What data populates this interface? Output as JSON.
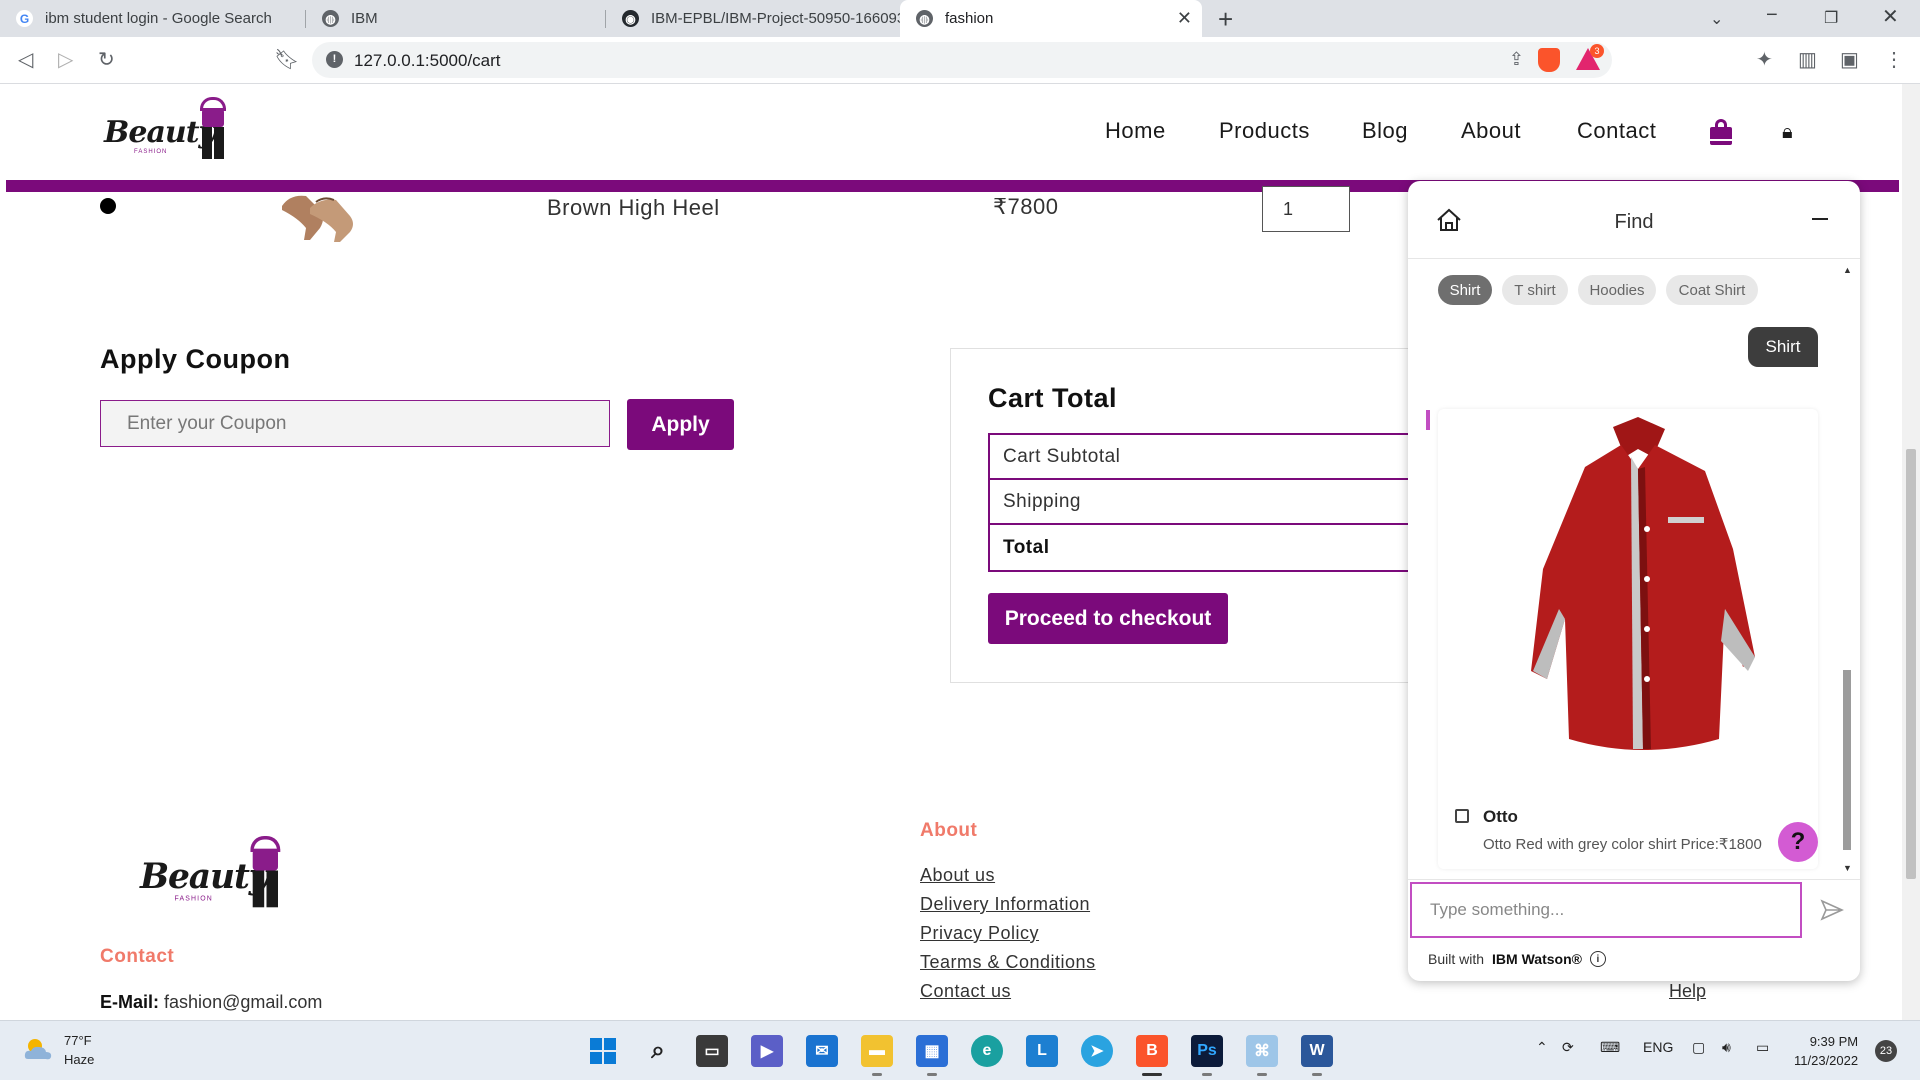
{
  "browser": {
    "tabs": [
      {
        "title": "ibm student login - Google Search",
        "icon": "google-icon"
      },
      {
        "title": "IBM",
        "icon": "globe-icon"
      },
      {
        "title": "IBM-EPBL/IBM-Project-50950-166093",
        "icon": "github-icon"
      },
      {
        "title": "fashion",
        "icon": "globe-icon",
        "active": true
      }
    ],
    "url": "127.0.0.1:5000/cart",
    "brave_badge": "3"
  },
  "site": {
    "logo_text": "Beauty",
    "logo_tagline": "FASHION",
    "nav": [
      "Home",
      "Products",
      "Blog",
      "About",
      "Contact"
    ],
    "accent_color": "#7b0a7b"
  },
  "cart": {
    "item": {
      "name": "Brown High Heel",
      "price": "₹7800",
      "quantity": "1"
    }
  },
  "coupon": {
    "title": "Apply Coupon",
    "placeholder": "Enter your Coupon",
    "button": "Apply"
  },
  "cart_total": {
    "title": "Cart Total",
    "rows": [
      "Cart Subtotal",
      "Shipping",
      "Total"
    ],
    "checkout_button": "Proceed to checkout"
  },
  "footer": {
    "contact_heading": "Contact",
    "email_label": "E-Mail:",
    "email_value": "fashion@gmail.com",
    "about_heading": "About",
    "about_links": [
      "About us",
      "Delivery Information",
      "Privacy Policy",
      "Tearms & Conditions",
      "Contact us"
    ],
    "help_link": "Help"
  },
  "chat": {
    "title": "Find",
    "chips": [
      "Shirt",
      "T shirt",
      "Hoodies",
      "Coat Shirt"
    ],
    "user_message": "Shirt",
    "card": {
      "title": "Otto",
      "description": "Otto Red with grey color shirt Price:₹1800"
    },
    "help_button": "?",
    "input_placeholder": "Type something...",
    "footer_prefix": "Built with",
    "footer_brand": "IBM Watson®"
  },
  "taskbar": {
    "weather_temp": "77°F",
    "weather_condition": "Haze",
    "language": "ENG",
    "time": "9:39 PM",
    "date": "11/23/2022",
    "notifications": "23"
  }
}
